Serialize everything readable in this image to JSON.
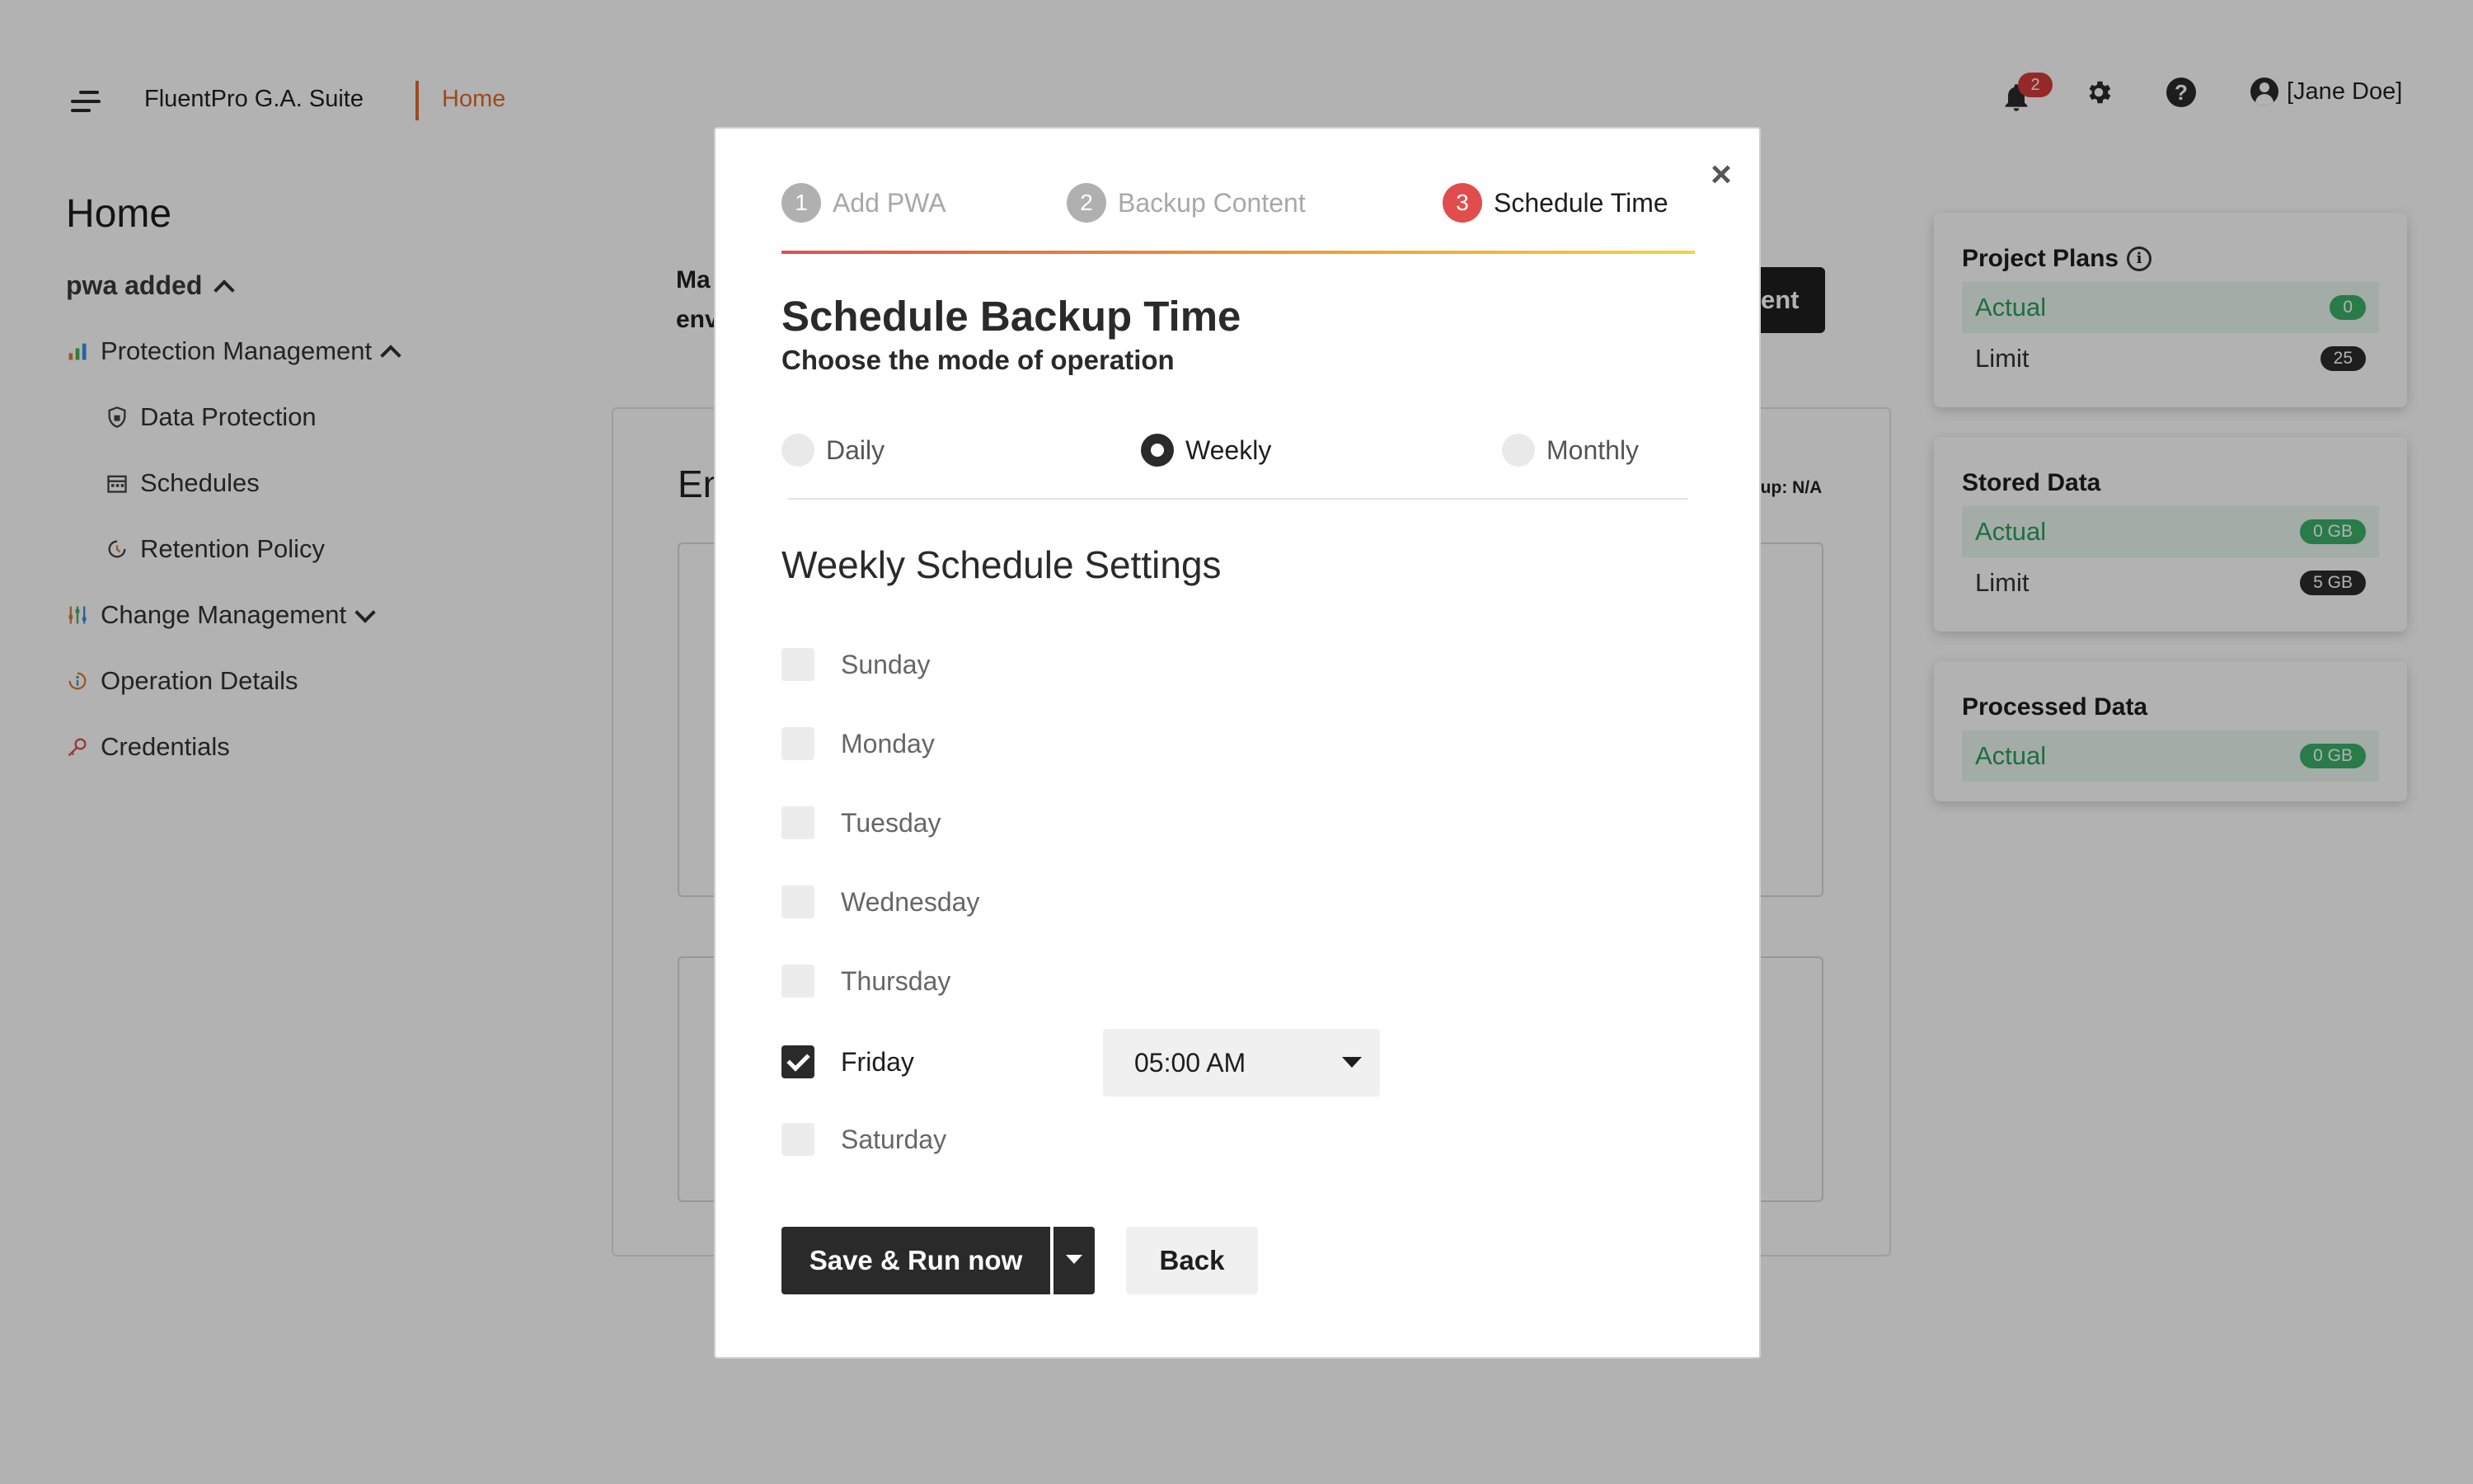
{
  "header": {
    "brand": "FluentPro G.A. Suite",
    "breadcrumb": "Home",
    "notification_count": "2",
    "user_name": "[Jane Doe]"
  },
  "sidebar": {
    "title": "Home",
    "subtitle": "pwa added",
    "items": [
      {
        "label": "Protection Management",
        "icon": "chart-bars-icon"
      },
      {
        "label": "Data Protection",
        "icon": "shield-icon"
      },
      {
        "label": "Schedules",
        "icon": "calendar-icon"
      },
      {
        "label": "Retention Policy",
        "icon": "retention-icon"
      },
      {
        "label": "Change Management",
        "icon": "sliders-icon"
      },
      {
        "label": "Operation Details",
        "icon": "info-icon"
      },
      {
        "label": "Credentials",
        "icon": "key-icon"
      }
    ]
  },
  "main": {
    "line1": "Ma",
    "line2": "env",
    "button_fragment": "ent",
    "card_title": "En",
    "card_right": "kup: N/A"
  },
  "stats": [
    {
      "title": "Project Plans",
      "actual_label": "Actual",
      "actual_value": "0",
      "limit_label": "Limit",
      "limit_value": "25"
    },
    {
      "title": "Stored Data",
      "actual_label": "Actual",
      "actual_value": "0 GB",
      "limit_label": "Limit",
      "limit_value": "5 GB"
    },
    {
      "title": "Processed Data",
      "actual_label": "Actual",
      "actual_value": "0 GB"
    }
  ],
  "modal": {
    "steps": [
      {
        "num": "1",
        "label": "Add PWA"
      },
      {
        "num": "2",
        "label": "Backup Content"
      },
      {
        "num": "3",
        "label": "Schedule Time"
      }
    ],
    "title": "Schedule Backup Time",
    "subtitle": "Choose the mode of operation",
    "modes": [
      "Daily",
      "Weekly",
      "Monthly"
    ],
    "selected_mode": "Weekly",
    "section_title": "Weekly Schedule Settings",
    "days": [
      "Sunday",
      "Monday",
      "Tuesday",
      "Wednesday",
      "Thursday",
      "Friday",
      "Saturday"
    ],
    "checked_day": "Friday",
    "time_value": "05:00 AM",
    "save_label": "Save & Run now",
    "back_label": "Back",
    "close_label": "×"
  },
  "colors": {
    "accent": "#e06b2c",
    "step_active": "#e14d4d",
    "primary_button": "#2a2a2a",
    "success": "#3bb06b"
  }
}
